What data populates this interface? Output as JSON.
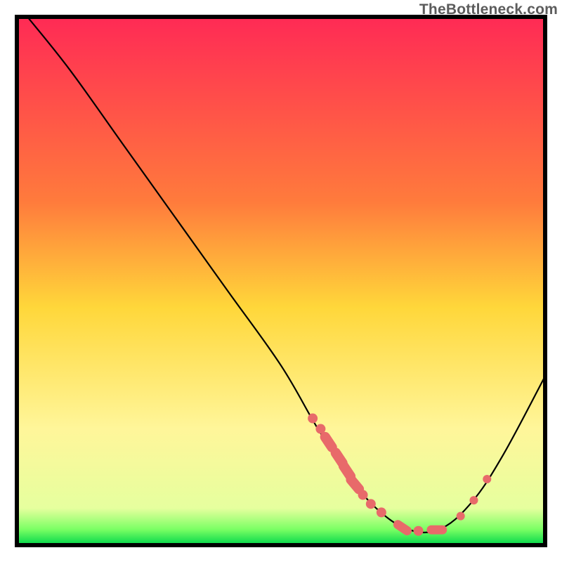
{
  "watermark": "TheBottleneck.com",
  "chart_data": {
    "type": "line",
    "title": "",
    "xlabel": "",
    "ylabel": "",
    "xlim": [
      0,
      100
    ],
    "ylim": [
      0,
      100
    ],
    "grid": false,
    "legend": false,
    "gradient_stops": [
      {
        "offset": 0,
        "color": "#ff2a55"
      },
      {
        "offset": 35,
        "color": "#ff7b3c"
      },
      {
        "offset": 55,
        "color": "#ffd73a"
      },
      {
        "offset": 78,
        "color": "#fff69a"
      },
      {
        "offset": 93,
        "color": "#e6ff9e"
      },
      {
        "offset": 97,
        "color": "#7bff64"
      },
      {
        "offset": 100,
        "color": "#00d64a"
      }
    ],
    "curve": [
      {
        "x": 2,
        "y": 100
      },
      {
        "x": 10,
        "y": 90
      },
      {
        "x": 20,
        "y": 76
      },
      {
        "x": 30,
        "y": 62
      },
      {
        "x": 40,
        "y": 48
      },
      {
        "x": 50,
        "y": 34
      },
      {
        "x": 57,
        "y": 22
      },
      {
        "x": 63,
        "y": 13
      },
      {
        "x": 68,
        "y": 7
      },
      {
        "x": 74,
        "y": 3
      },
      {
        "x": 80,
        "y": 3
      },
      {
        "x": 86,
        "y": 8
      },
      {
        "x": 92,
        "y": 17
      },
      {
        "x": 100,
        "y": 32
      }
    ],
    "markers": [
      {
        "x": 56,
        "y": 24,
        "size": 7
      },
      {
        "x": 57.5,
        "y": 22,
        "size": 7
      },
      {
        "x": 59,
        "y": 19.5,
        "size": 10,
        "elongated": true
      },
      {
        "x": 61,
        "y": 16.5,
        "size": 10,
        "elongated": true
      },
      {
        "x": 62.5,
        "y": 14,
        "size": 10,
        "elongated": true
      },
      {
        "x": 64,
        "y": 11.5,
        "size": 10,
        "elongated": true
      },
      {
        "x": 65.5,
        "y": 9.5,
        "size": 7
      },
      {
        "x": 67,
        "y": 7.8,
        "size": 7
      },
      {
        "x": 69,
        "y": 6.2,
        "size": 7
      },
      {
        "x": 73,
        "y": 3.3,
        "size": 9,
        "elongated": true
      },
      {
        "x": 76,
        "y": 2.7,
        "size": 7
      },
      {
        "x": 79.5,
        "y": 2.9,
        "size": 9,
        "elongated": true
      },
      {
        "x": 84,
        "y": 5.5,
        "size": 6
      },
      {
        "x": 86.5,
        "y": 8.5,
        "size": 6
      },
      {
        "x": 89,
        "y": 12.5,
        "size": 6
      }
    ],
    "marker_color": "#e86a6a",
    "curve_color": "#000000",
    "frame_color": "#000000"
  }
}
